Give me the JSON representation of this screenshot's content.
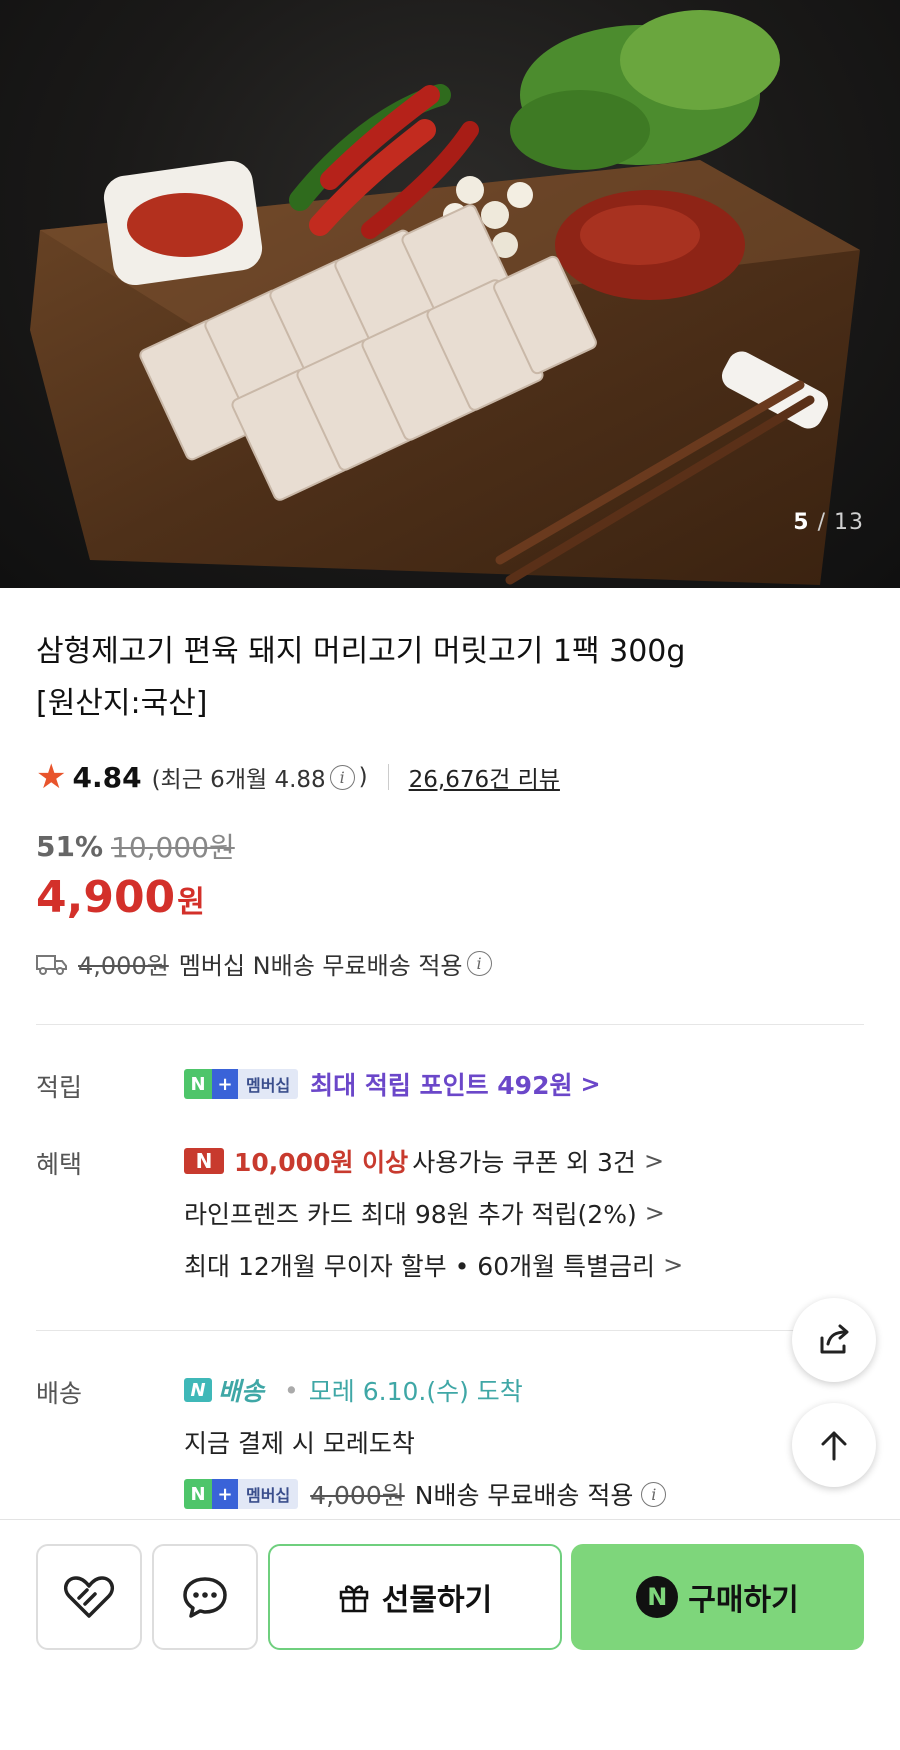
{
  "gallery": {
    "current": "5",
    "separator": "/",
    "total": "13"
  },
  "product": {
    "title_line1": "삼형제고기 편육 돼지 머리고기 머릿고기 1팩 300g",
    "title_line2": "[원산지:국산]"
  },
  "rating": {
    "score": "4.84",
    "recent_label": "(최근 6개월 4.88",
    "recent_close": ")",
    "review_link": "26,676건 리뷰"
  },
  "price": {
    "discount_pct": "51%",
    "original": "10,000원",
    "sale_number": "4,900",
    "sale_unit": "원"
  },
  "shipping_summary": {
    "original_fee": "4,000원",
    "text": "멤버십 N배송 무료배송 적용"
  },
  "membership_badge": {
    "n": "N",
    "plus": "+",
    "label": "멤버십"
  },
  "points": {
    "label": "적립",
    "text": "최대 적립 포인트 492원"
  },
  "benefits": {
    "label": "혜택",
    "coupon_badge": "N",
    "coupon_highlight": "10,000원 이상",
    "coupon_text": "사용가능 쿠폰 외 3건",
    "card_text": "라인프렌즈 카드 최대 98원 추가 적립(2%)",
    "installment_text": "최대 12개월 무이자 할부 • 60개월 특별금리"
  },
  "delivery": {
    "label": "배송",
    "badge_n": "N",
    "badge_word": "배송",
    "eta": "모레 6.10.(수) 도착",
    "note": "지금 결제 시 모레도착",
    "original_fee": "4,000원",
    "free_text": "N배송 무료배송 적용"
  },
  "actions": {
    "gift_label": "선물하기",
    "buy_badge": "N",
    "buy_label": "구매하기"
  },
  "colors": {
    "sale_red": "#d3302a",
    "membership_purple": "#6b47c9",
    "delivery_teal": "#3fa7a6",
    "buy_green": "#7ed67b"
  }
}
